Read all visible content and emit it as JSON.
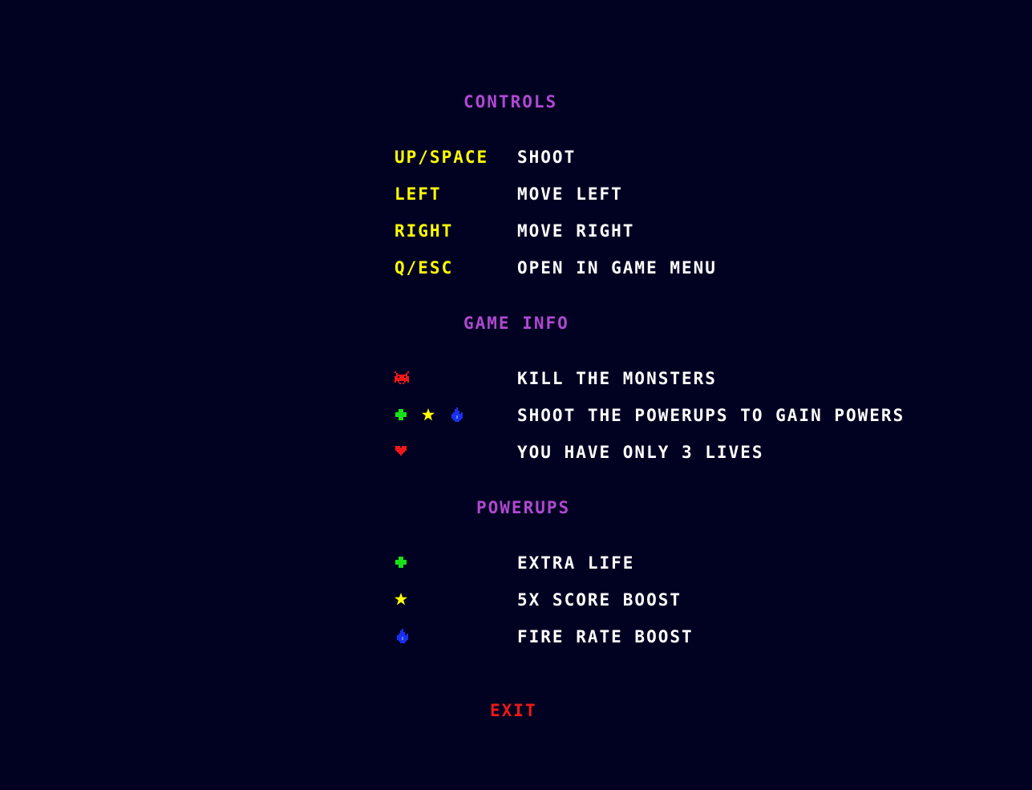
{
  "controls": {
    "heading": "CONTROLS",
    "rows": [
      {
        "key": "UP/SPACE",
        "action": "SHOOT"
      },
      {
        "key": "LEFT",
        "action": "MOVE LEFT"
      },
      {
        "key": "RIGHT",
        "action": "MOVE RIGHT"
      },
      {
        "key": "Q/ESC",
        "action": "OPEN IN GAME MENU"
      }
    ]
  },
  "game_info": {
    "heading": "GAME INFO",
    "rows": [
      {
        "icons": [
          "monster-icon"
        ],
        "text": "KILL THE MONSTERS"
      },
      {
        "icons": [
          "plus-icon",
          "star-icon",
          "flame-icon"
        ],
        "text": "SHOOT THE POWERUPS TO GAIN POWERS"
      },
      {
        "icons": [
          "heart-icon"
        ],
        "text": "YOU HAVE ONLY 3 LIVES"
      }
    ]
  },
  "powerups": {
    "heading": "POWERUPS",
    "rows": [
      {
        "icon": "plus-icon",
        "text": "EXTRA LIFE"
      },
      {
        "icon": "star-icon",
        "text": "5X SCORE BOOST"
      },
      {
        "icon": "flame-icon",
        "text": "FIRE RATE BOOST"
      }
    ]
  },
  "exit_label": "EXIT",
  "colors": {
    "background": "#010222",
    "heading": "#b048d0",
    "key": "#ffff00",
    "text": "#ffffff",
    "exit": "#f01818",
    "monster": "#f01818",
    "heart": "#f01818",
    "plus": "#18e018",
    "star": "#ffff00",
    "flame": "#1830f0"
  }
}
